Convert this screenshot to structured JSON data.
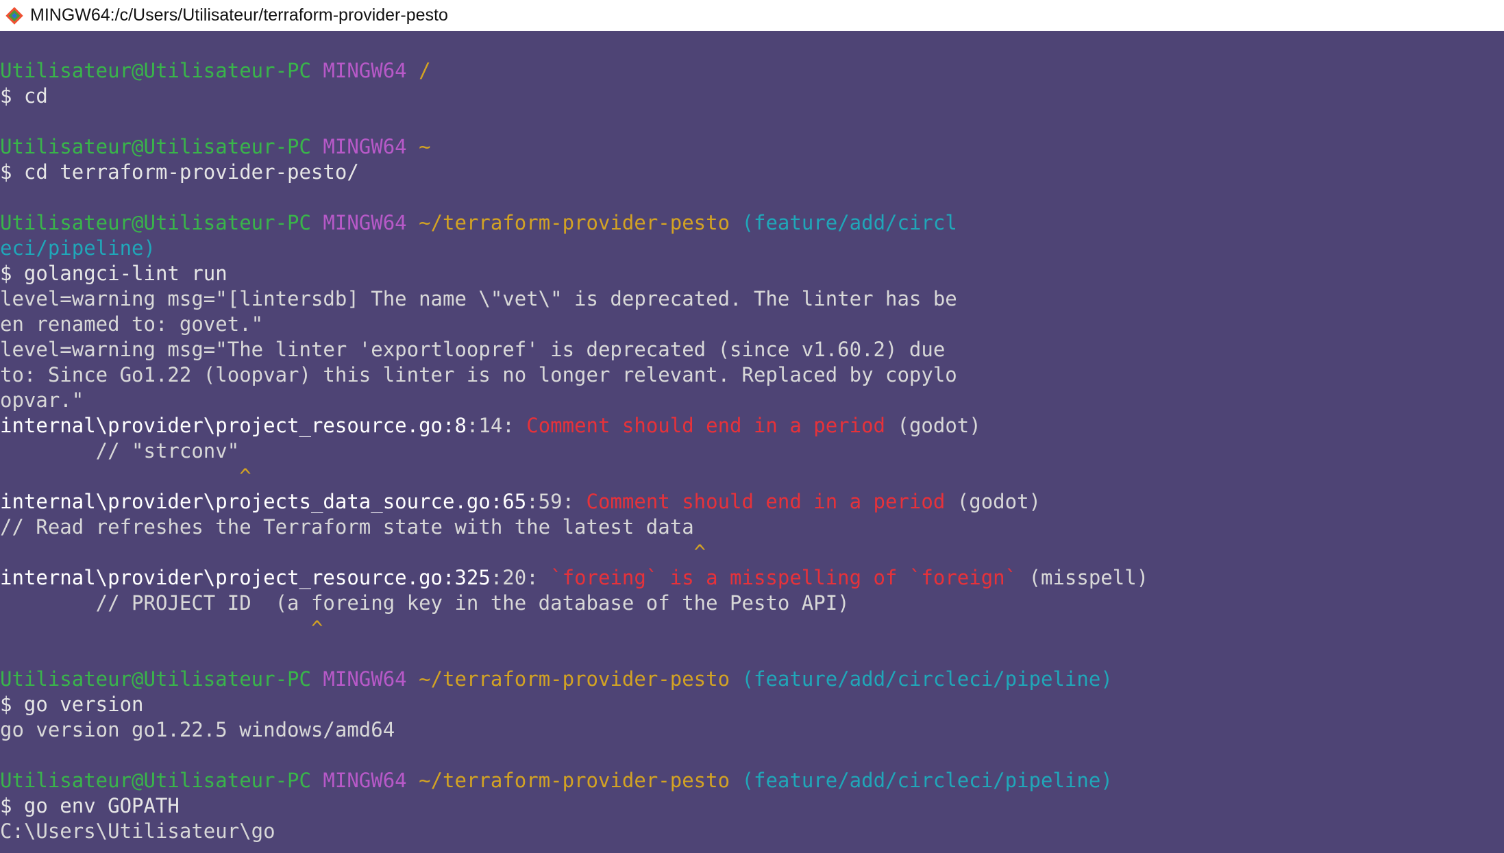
{
  "window": {
    "title": "MINGW64:/c/Users/Utilisateur/terraform-provider-pesto",
    "icon": "git-bash-icon"
  },
  "colors": {
    "background": "#4e4475",
    "user": "#39b54a",
    "host": "#b759c8",
    "path": "#d3a323",
    "branch": "#20a7b9",
    "error": "#e6323a",
    "text": "#e6e6e6"
  },
  "prompt": {
    "user": "Utilisateur@Utilisateur-PC",
    "host": "MINGW64"
  },
  "lines": {
    "p1_path": "/",
    "c1": "$ cd",
    "p2_path": "~",
    "c2": "$ cd terraform-provider-pesto/",
    "p3_path": "~/terraform-provider-pesto",
    "p3_branch_a": "(feature/add/circl",
    "p3_branch_b": "eci/pipeline)",
    "c3": "$ golangci-lint run",
    "w1a": "level=warning msg=\"[lintersdb] The name \\\"vet\\\" is deprecated. The linter has be",
    "w1b": "en renamed to: govet.\"",
    "w2a": "level=warning msg=\"The linter 'exportloopref' is deprecated (since v1.60.2) due",
    "w2b": "to: Since Go1.22 (loopvar) this linter is no longer relevant. Replaced by copylo",
    "w2c": "opvar.\"",
    "e1_file": "internal\\provider\\project_resource.go:8",
    "e1_col": ":14: ",
    "e1_msg": "Comment should end in a period",
    "e1_tag": " (godot)",
    "e1_src": "        // \"strconv\"",
    "e1_caret": "                    ^",
    "e2_file": "internal\\provider\\projects_data_source.go:65",
    "e2_col": ":59: ",
    "e2_msg": "Comment should end in a period",
    "e2_tag": " (godot)",
    "e2_src": "// Read refreshes the Terraform state with the latest data",
    "e2_caret": "                                                          ^",
    "e3_file": "internal\\provider\\project_resource.go:325",
    "e3_col": ":20: ",
    "e3_msg": "`foreing` is a misspelling of `foreign`",
    "e3_tag": " (misspell)",
    "e3_src": "        // PROJECT ID  (a foreing key in the database of the Pesto API)",
    "e3_caret": "                          ^",
    "p4_path": "~/terraform-provider-pesto",
    "p4_branch": "(feature/add/circleci/pipeline)",
    "c4": "$ go version",
    "o4": "go version go1.22.5 windows/amd64",
    "p5_path": "~/terraform-provider-pesto",
    "p5_branch": "(feature/add/circleci/pipeline)",
    "c5": "$ go env GOPATH",
    "o5": "C:\\Users\\Utilisateur\\go"
  }
}
